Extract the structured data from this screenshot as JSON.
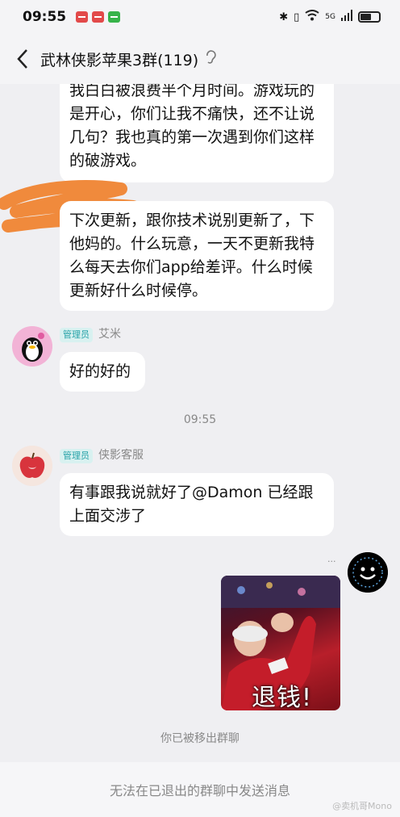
{
  "status_bar": {
    "time": "09:55",
    "network": "5G",
    "icons": [
      "message-red-icon",
      "message-red-icon",
      "phone-green-icon",
      "bluetooth-icon",
      "vibrate-icon",
      "wifi-icon",
      "signal-icon",
      "battery-icon"
    ],
    "battery_level": 0.6
  },
  "header": {
    "title": "武林侠影苹果3群(119)",
    "back_icon": "chevron-left-icon",
    "ear_icon": "ear-icon"
  },
  "messages": [
    {
      "text": "我白白被浪费半个月时间。游戏玩的是开心，你们让我不痛快，还不让说几句？我也真的第一次遇到你们这样的破游戏。"
    },
    {
      "text": "下次更新，跟你技术说别更新了，下他妈的。什么玩意，一天不更新我特么每天去你们app给差评。什么时候更新好什么时候停。"
    },
    {
      "badge": "管理员",
      "sender": "艾米",
      "text": "好的好的"
    },
    {
      "time": "09:55"
    },
    {
      "badge": "管理员",
      "sender": "侠影客服",
      "text": "有事跟我说就好了@Damon  已经跟上面交涉了"
    },
    {
      "sender": "...",
      "image_caption": "退钱!"
    }
  ],
  "system_message": "你已被移出群聊",
  "footer": {
    "text": "无法在已退出的群聊中发送消息",
    "watermark": "@卖机哥Mono"
  },
  "colors": {
    "background": "#efeff2",
    "bubble": "#ffffff",
    "admin_badge_text": "#27a2a8",
    "admin_badge_bg": "#d8f1f0",
    "scribble": "#f08a3c"
  }
}
